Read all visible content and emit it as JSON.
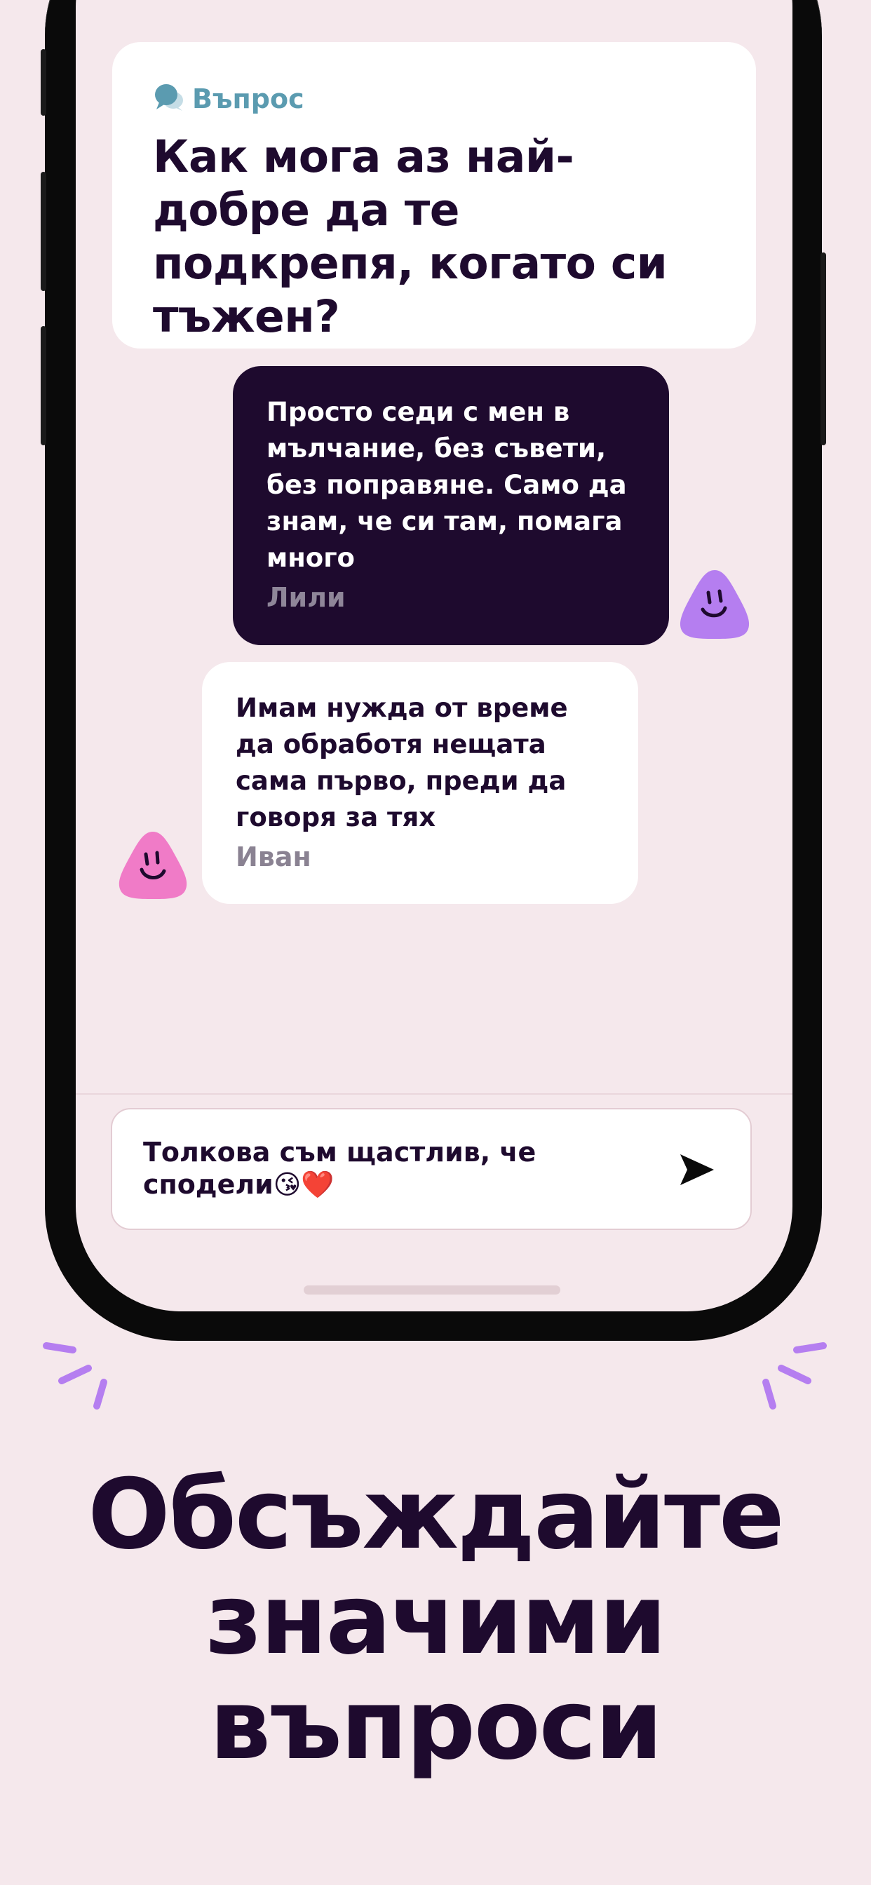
{
  "question": {
    "tag": "Въпрос",
    "text": "Как мога аз най-добре да те подкрепя, когато си тъжен?"
  },
  "messages": [
    {
      "text": "Просто седи с мен в мълчание, без съвети, без поправяне. Само да знам, че си там, помага много",
      "author": "Лили",
      "avatar_color": "#b57ef0"
    },
    {
      "text": "Имам нужда от време да обработя нещата сама първо, преди да говоря за тях",
      "author": "Иван",
      "avatar_color": "#f07bc7"
    }
  ],
  "composer": {
    "value": "Толкова съм щастлив, че сподели😘❤️"
  },
  "caption": {
    "lines": [
      "Обсъждайте",
      "значими",
      "въпроси"
    ]
  },
  "colors": {
    "background": "#f5e8ec",
    "ink": "#1e0a2e",
    "accent": "#b57ef0",
    "tag": "#5b9bb0"
  },
  "icons": {
    "tag": "speech-bubbles-icon",
    "send": "send-icon"
  }
}
